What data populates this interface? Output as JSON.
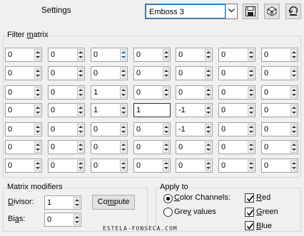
{
  "toolbar": {
    "settings_label": "Settings",
    "preset_value": "Emboss 3",
    "icons": [
      "save-icon",
      "delete-icon",
      "reset-icon"
    ]
  },
  "filter_matrix": {
    "title_pre": "Filter ",
    "title_mn": "m",
    "title_post": "atrix",
    "rows": [
      [
        "0",
        "0",
        "0",
        "0",
        "0",
        "0",
        "0"
      ],
      [
        "0",
        "0",
        "0",
        "0",
        "0",
        "0",
        "0"
      ],
      [
        "0",
        "0",
        "1",
        "0",
        "0",
        "0",
        "0"
      ],
      [
        "0",
        "0",
        "1",
        "1",
        "-1",
        "0",
        "0"
      ],
      [
        "0",
        "0",
        "0",
        "0",
        "-1",
        "0",
        "0"
      ],
      [
        "0",
        "0",
        "0",
        "0",
        "0",
        "0",
        "0"
      ],
      [
        "0",
        "0",
        "0",
        "0",
        "0",
        "0",
        "0"
      ]
    ]
  },
  "matrix_modifiers": {
    "title": "Matrix modifiers",
    "divisor_mn": "D",
    "divisor_rest": "ivisor:",
    "divisor_value": "1",
    "bias_pre": "Bi",
    "bias_mn": "a",
    "bias_post": "s:",
    "bias_value": "0",
    "compute_pre": "Co",
    "compute_mn": "m",
    "compute_post": "pute"
  },
  "apply_to": {
    "title": "Apply to",
    "color_channels_mn": "C",
    "color_channels_rest": "olor Channels:",
    "grey_values_pre": "Gre",
    "grey_values_mn": "y",
    "grey_values_post": " values",
    "selected": "color_channels",
    "red_mn": "R",
    "red_rest": "ed",
    "green_mn": "G",
    "green_rest": "reen",
    "blue_mn": "B",
    "blue_rest": "lue",
    "red_checked": true,
    "green_checked": true,
    "blue_checked": true
  },
  "watermark": "ESTELA-FONSECA.COM"
}
